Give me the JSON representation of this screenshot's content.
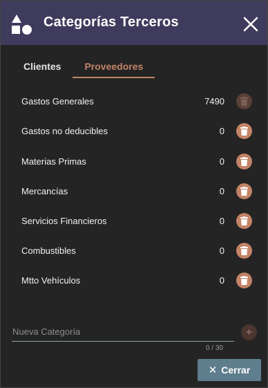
{
  "header": {
    "title": "Categorías Terceros"
  },
  "tabs": [
    {
      "label": "Clientes",
      "active": false
    },
    {
      "label": "Proveedores",
      "active": true
    }
  ],
  "categories": [
    {
      "name": "Gastos Generales",
      "count": "7490",
      "delete_enabled": false
    },
    {
      "name": "Gastos no deducibles",
      "count": "0",
      "delete_enabled": true
    },
    {
      "name": "Materias Primas",
      "count": "0",
      "delete_enabled": true
    },
    {
      "name": "Mercancías",
      "count": "0",
      "delete_enabled": true
    },
    {
      "name": "Servicios Financieros",
      "count": "0",
      "delete_enabled": true
    },
    {
      "name": "Combustibles",
      "count": "0",
      "delete_enabled": true
    },
    {
      "name": "Mtto Vehículos",
      "count": "0",
      "delete_enabled": true
    }
  ],
  "new_category": {
    "placeholder": "Nueva Categoría",
    "value": "",
    "counter": "0 / 30"
  },
  "footer": {
    "close_label": "Cerrar"
  },
  "colors": {
    "header": "#3f3b5c",
    "accent": "#c38367",
    "button": "#5f7e8d"
  },
  "icons": {
    "logo": "shapes-icon",
    "close": "close-icon",
    "delete": "trash-icon",
    "add": "plus-icon"
  }
}
